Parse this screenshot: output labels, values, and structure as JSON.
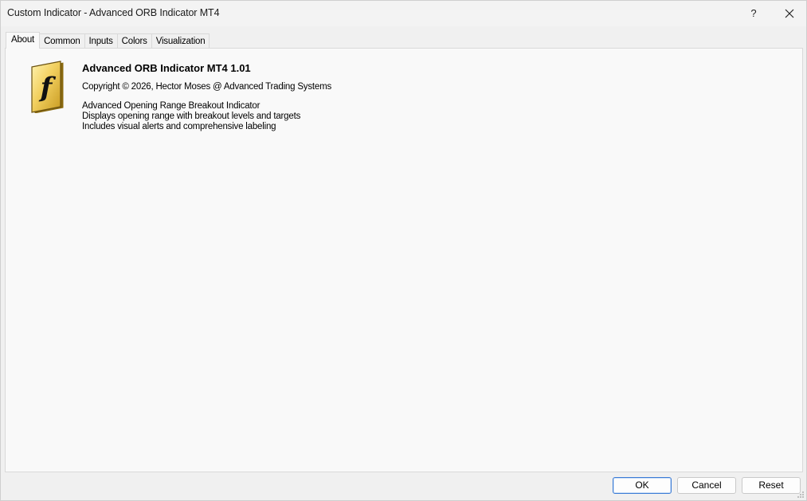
{
  "window": {
    "title": "Custom Indicator - Advanced ORB Indicator MT4",
    "help_label": "?"
  },
  "tabs": [
    {
      "label": "About",
      "active": true
    },
    {
      "label": "Common",
      "active": false
    },
    {
      "label": "Inputs",
      "active": false
    },
    {
      "label": "Colors",
      "active": false
    },
    {
      "label": "Visualization",
      "active": false
    }
  ],
  "about": {
    "logo_icon": "function-f-icon",
    "name": "Advanced ORB Indicator MT4 1.01",
    "copyright": "Copyright © 2026, Hector Moses @ Advanced Trading Systems",
    "description": [
      "Advanced Opening Range Breakout Indicator",
      "Displays opening range with breakout levels and targets",
      "Includes visual alerts and comprehensive labeling"
    ]
  },
  "buttons": {
    "ok": "OK",
    "cancel": "Cancel",
    "reset": "Reset"
  },
  "colors": {
    "accent": "#3a7bd5",
    "logo_gold": "#e8c040"
  }
}
